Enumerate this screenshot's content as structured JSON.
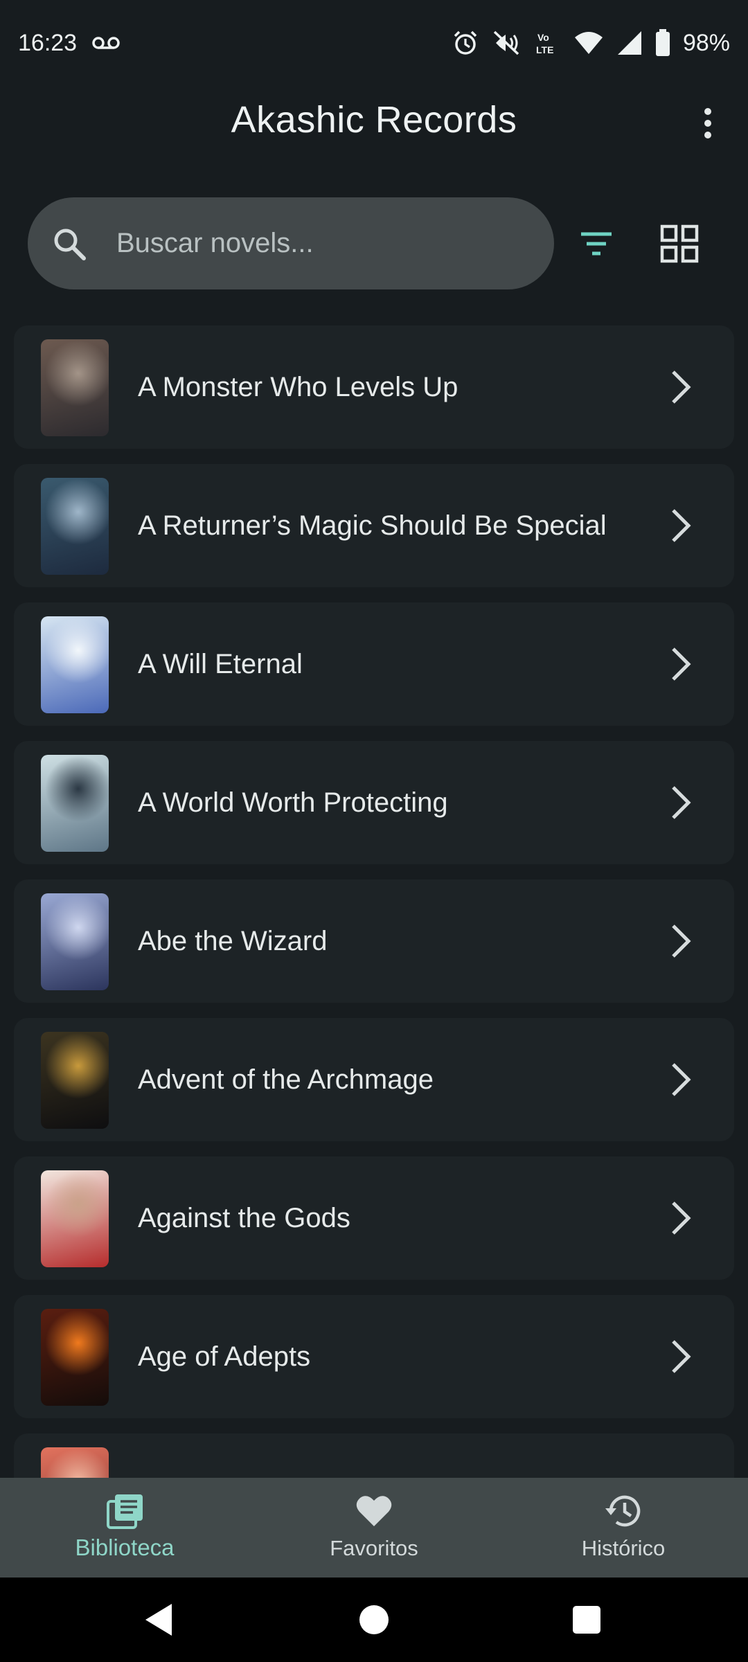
{
  "status_bar": {
    "time": "16:23",
    "battery": "98%",
    "icons": [
      "voicemail-icon",
      "alarm-icon",
      "vibrate-off-icon",
      "volte-icon",
      "wifi-icon",
      "signal-icon",
      "battery-icon"
    ]
  },
  "app_bar": {
    "title": "Akashic Records",
    "more_icon": "more-vert-icon"
  },
  "search": {
    "placeholder": "Buscar novels...",
    "value": "",
    "filter_icon": "filter-icon",
    "grid_icon": "grid-view-icon"
  },
  "novels": [
    {
      "title": "A Monster Who Levels Up",
      "cover_colors": [
        "#6d5a50",
        "#2c2a2e",
        "#a39488"
      ]
    },
    {
      "title": "A Returner’s Magic Should Be Special",
      "cover_colors": [
        "#3a5a6e",
        "#1d2a3e",
        "#9fb6c9"
      ]
    },
    {
      "title": "A Will Eternal",
      "cover_colors": [
        "#d7e6f2",
        "#4b69b8",
        "#f2f7fb"
      ]
    },
    {
      "title": "A World Worth Protecting",
      "cover_colors": [
        "#cfe0e4",
        "#5e7687",
        "#2b3844"
      ]
    },
    {
      "title": "Abe the Wizard",
      "cover_colors": [
        "#9aa9d4",
        "#2c355d",
        "#cfd7ef"
      ]
    },
    {
      "title": "Advent of the Archmage",
      "cover_colors": [
        "#3c3420",
        "#0e0e10",
        "#c89a3c"
      ]
    },
    {
      "title": "Against the Gods",
      "cover_colors": [
        "#f2e7df",
        "#b52c2c",
        "#caa28a"
      ]
    },
    {
      "title": "Age of Adepts",
      "cover_colors": [
        "#5a1e10",
        "#140c0a",
        "#f07a1e"
      ]
    },
    {
      "title": "",
      "cover_colors": [
        "#e2735e",
        "#7a2c2a",
        "#f2b8a0"
      ]
    }
  ],
  "bottom_nav": [
    {
      "label": "Biblioteca",
      "icon": "library-icon",
      "active": true
    },
    {
      "label": "Favoritos",
      "icon": "heart-icon",
      "active": false
    },
    {
      "label": "Histórico",
      "icon": "history-icon",
      "active": false
    }
  ],
  "colors": {
    "background": "#171c1f",
    "card": "#1d2326",
    "accent": "#8fd6c8",
    "search_pill": "#42484a",
    "nav_bar": "#41494a"
  }
}
